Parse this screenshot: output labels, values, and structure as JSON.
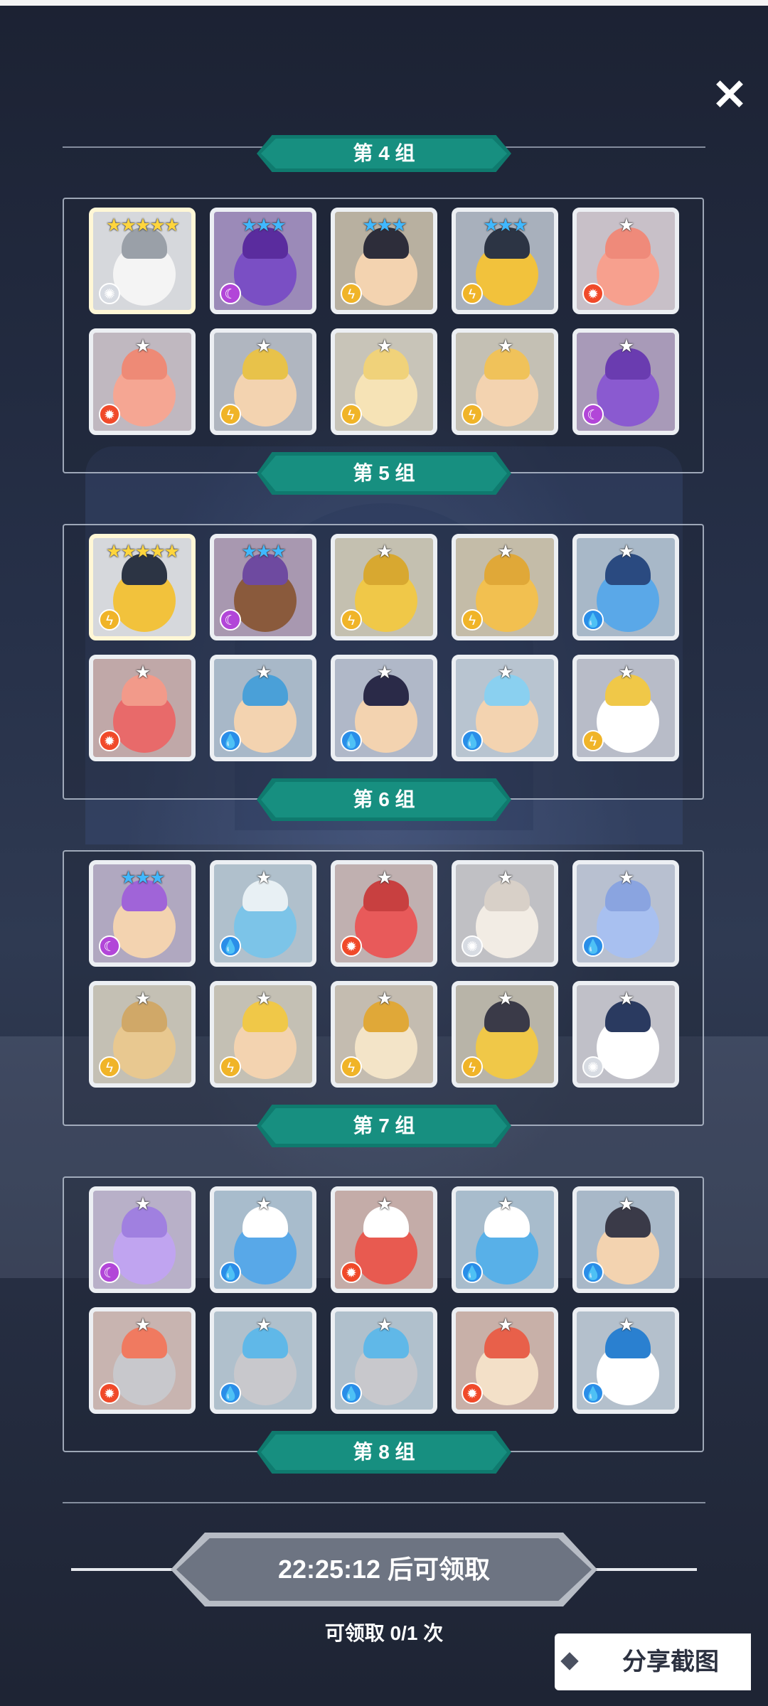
{
  "close_label": "✕",
  "partial_group_title": "第 4 组",
  "groups": [
    {
      "title": "第 5 组",
      "heroes": [
        {
          "stars": "★★★★★",
          "star_color": "#ffd53d",
          "element": "light",
          "elem_color": "#d7dbe2",
          "bg": "#d6d8dc",
          "body": "#f4f4f4",
          "hair": "#9aa0a8",
          "selected": true
        },
        {
          "stars": "★★★",
          "star_color": "#40b8ff",
          "element": "dark",
          "elem_color": "#b246d8",
          "bg": "#9b8ab8",
          "body": "#7a4fc4",
          "hair": "#5a2c9e",
          "selected": false
        },
        {
          "stars": "★★★",
          "star_color": "#40b8ff",
          "element": "thunder",
          "elem_color": "#f0b428",
          "bg": "#b8b0a0",
          "body": "#f3d3b0",
          "hair": "#2d2d3a",
          "selected": false
        },
        {
          "stars": "★★★",
          "star_color": "#40b8ff",
          "element": "thunder",
          "elem_color": "#f0b428",
          "bg": "#a8b0bc",
          "body": "#f2c23c",
          "hair": "#2c3444",
          "selected": false
        },
        {
          "stars": "★",
          "star_color": "#ffffff",
          "element": "fire",
          "elem_color": "#f04a2a",
          "bg": "#c8c0c8",
          "body": "#f7a08e",
          "hair": "#ef8a7a",
          "selected": false
        },
        {
          "stars": "★",
          "star_color": "#ffffff",
          "element": "fire",
          "elem_color": "#f04a2a",
          "bg": "#c0b8c0",
          "body": "#f5a693",
          "hair": "#ee8a76",
          "selected": false
        },
        {
          "stars": "★",
          "star_color": "#ffffff",
          "element": "thunder",
          "elem_color": "#f0b428",
          "bg": "#b0b6c0",
          "body": "#f3d3b0",
          "hair": "#e8c24a",
          "selected": false
        },
        {
          "stars": "★",
          "star_color": "#ffffff",
          "element": "thunder",
          "elem_color": "#f0b428",
          "bg": "#c8c4b8",
          "body": "#f6e3b6",
          "hair": "#f0d27a",
          "selected": false
        },
        {
          "stars": "★",
          "star_color": "#ffffff",
          "element": "thunder",
          "elem_color": "#f0b428",
          "bg": "#c4c0b4",
          "body": "#f3d3b0",
          "hair": "#f0c25a",
          "selected": false
        },
        {
          "stars": "★",
          "star_color": "#ffffff",
          "element": "dark",
          "elem_color": "#b246d8",
          "bg": "#a89ab8",
          "body": "#8a5ad0",
          "hair": "#6a3cb0",
          "selected": false
        }
      ]
    },
    {
      "title": "第 6 组",
      "heroes": [
        {
          "stars": "★★★★★",
          "star_color": "#ffd53d",
          "element": "thunder",
          "elem_color": "#f0b428",
          "bg": "#d6d8dc",
          "body": "#f2c23c",
          "hair": "#2c3444",
          "selected": true
        },
        {
          "stars": "★★★",
          "star_color": "#40b8ff",
          "element": "dark",
          "elem_color": "#b246d8",
          "bg": "#a898b0",
          "body": "#8a5a3c",
          "hair": "#6e4aa0",
          "selected": false
        },
        {
          "stars": "★",
          "star_color": "#ffffff",
          "element": "thunder",
          "elem_color": "#f0b428",
          "bg": "#c4c0b0",
          "body": "#f0c848",
          "hair": "#d8a830",
          "selected": false
        },
        {
          "stars": "★",
          "star_color": "#ffffff",
          "element": "thunder",
          "elem_color": "#f0b428",
          "bg": "#c4bca8",
          "body": "#f2c050",
          "hair": "#e0a838",
          "selected": false
        },
        {
          "stars": "★",
          "star_color": "#ffffff",
          "element": "water",
          "elem_color": "#2a8ee8",
          "bg": "#a8b8c8",
          "body": "#5aa8e8",
          "hair": "#2a4a80",
          "selected": false
        },
        {
          "stars": "★",
          "star_color": "#ffffff",
          "element": "fire",
          "elem_color": "#f04a2a",
          "bg": "#c0a8a8",
          "body": "#e86a6a",
          "hair": "#f29a8a",
          "selected": false
        },
        {
          "stars": "★",
          "star_color": "#ffffff",
          "element": "water",
          "elem_color": "#2a8ee8",
          "bg": "#a8b8c8",
          "body": "#f3d3b0",
          "hair": "#4aa0d8",
          "selected": false
        },
        {
          "stars": "★",
          "star_color": "#ffffff",
          "element": "water",
          "elem_color": "#2a8ee8",
          "bg": "#b0b8c8",
          "body": "#f3d3b0",
          "hair": "#2a2a48",
          "selected": false
        },
        {
          "stars": "★",
          "star_color": "#ffffff",
          "element": "water",
          "elem_color": "#2a8ee8",
          "bg": "#b8c4d0",
          "body": "#f3d3b0",
          "hair": "#8ad0f0",
          "selected": false
        },
        {
          "stars": "★",
          "star_color": "#ffffff",
          "element": "thunder",
          "elem_color": "#f0b428",
          "bg": "#b8bcc8",
          "body": "#ffffff",
          "hair": "#f0c848",
          "selected": false
        }
      ]
    },
    {
      "title": "第 7 组",
      "heroes": [
        {
          "stars": "★★★",
          "star_color": "#40b8ff",
          "element": "dark",
          "elem_color": "#b246d8",
          "bg": "#b0a8c0",
          "body": "#f3d3b0",
          "hair": "#a064d8",
          "selected": false
        },
        {
          "stars": "★",
          "star_color": "#ffffff",
          "element": "water",
          "elem_color": "#2a8ee8",
          "bg": "#b0c0cc",
          "body": "#7cc4e8",
          "hair": "#e8f0f4",
          "selected": false
        },
        {
          "stars": "★",
          "star_color": "#ffffff",
          "element": "fire",
          "elem_color": "#f04a2a",
          "bg": "#c0b0b0",
          "body": "#e85a5a",
          "hair": "#c84040",
          "selected": false
        },
        {
          "stars": "★",
          "star_color": "#ffffff",
          "element": "light",
          "elem_color": "#d7dbe2",
          "bg": "#c0c0c4",
          "body": "#f2ece4",
          "hair": "#d8d0c8",
          "selected": false
        },
        {
          "stars": "★",
          "star_color": "#ffffff",
          "element": "water",
          "elem_color": "#2a8ee8",
          "bg": "#b8c0d0",
          "body": "#a8c0f0",
          "hair": "#8aa4e0",
          "selected": false
        },
        {
          "stars": "★",
          "star_color": "#ffffff",
          "element": "thunder",
          "elem_color": "#f0b428",
          "bg": "#c4c0b4",
          "body": "#e8c890",
          "hair": "#d0a868",
          "selected": false
        },
        {
          "stars": "★",
          "star_color": "#ffffff",
          "element": "thunder",
          "elem_color": "#f0b428",
          "bg": "#c4c0b4",
          "body": "#f3d3b0",
          "hair": "#f0c848",
          "selected": false
        },
        {
          "stars": "★",
          "star_color": "#ffffff",
          "element": "thunder",
          "elem_color": "#f0b428",
          "bg": "#c4bcb0",
          "body": "#f3e4c8",
          "hair": "#e0a838",
          "selected": false
        },
        {
          "stars": "★",
          "star_color": "#ffffff",
          "element": "thunder",
          "elem_color": "#f0b428",
          "bg": "#b8b4a8",
          "body": "#f0c848",
          "hair": "#3a3a48",
          "selected": false
        },
        {
          "stars": "★",
          "star_color": "#ffffff",
          "element": "light",
          "elem_color": "#d7dbe2",
          "bg": "#c0c0c8",
          "body": "#ffffff",
          "hair": "#2a3a60",
          "selected": false
        }
      ]
    },
    {
      "title": "第 8 组",
      "heroes": [
        {
          "stars": "★",
          "star_color": "#ffffff",
          "element": "dark",
          "elem_color": "#b246d8",
          "bg": "#b8b0c8",
          "body": "#c0a4f0",
          "hair": "#a080e0",
          "selected": false
        },
        {
          "stars": "★",
          "star_color": "#ffffff",
          "element": "water",
          "elem_color": "#2a8ee8",
          "bg": "#a8bccc",
          "body": "#58a8e8",
          "hair": "#ffffff",
          "selected": false
        },
        {
          "stars": "★",
          "star_color": "#ffffff",
          "element": "fire",
          "elem_color": "#f04a2a",
          "bg": "#c4aca8",
          "body": "#e85a50",
          "hair": "#ffffff",
          "selected": false
        },
        {
          "stars": "★",
          "star_color": "#ffffff",
          "element": "water",
          "elem_color": "#2a8ee8",
          "bg": "#a8bccc",
          "body": "#58b0e8",
          "hair": "#ffffff",
          "selected": false
        },
        {
          "stars": "★",
          "star_color": "#ffffff",
          "element": "water",
          "elem_color": "#2a8ee8",
          "bg": "#a8b8c8",
          "body": "#f3d3b0",
          "hair": "#3a3a48",
          "selected": false
        },
        {
          "stars": "★",
          "star_color": "#ffffff",
          "element": "fire",
          "elem_color": "#f04a2a",
          "bg": "#c8b4b0",
          "body": "#c8c8cc",
          "hair": "#f07a60",
          "selected": false
        },
        {
          "stars": "★",
          "star_color": "#ffffff",
          "element": "water",
          "elem_color": "#2a8ee8",
          "bg": "#b0c0cc",
          "body": "#c8c8cc",
          "hair": "#60b8e8",
          "selected": false
        },
        {
          "stars": "★",
          "star_color": "#ffffff",
          "element": "water",
          "elem_color": "#2a8ee8",
          "bg": "#b0c0cc",
          "body": "#c8c8cc",
          "hair": "#60b8e8",
          "selected": false
        },
        {
          "stars": "★",
          "star_color": "#ffffff",
          "element": "fire",
          "elem_color": "#f04a2a",
          "bg": "#c8b0a8",
          "body": "#f3e0c8",
          "hair": "#e8604a",
          "selected": false
        },
        {
          "stars": "★",
          "star_color": "#ffffff",
          "element": "water",
          "elem_color": "#2a8ee8",
          "bg": "#b4c0cc",
          "body": "#ffffff",
          "hair": "#2a80d0",
          "selected": false
        }
      ]
    }
  ],
  "countdown": "22:25:12 后可领取",
  "claim_count": "可领取 0/1 次",
  "share_label": "分享截图",
  "colors": {
    "banner": "#178f80",
    "banner_edge": "#0f7a6e",
    "timer_fill": "#6d7482"
  }
}
